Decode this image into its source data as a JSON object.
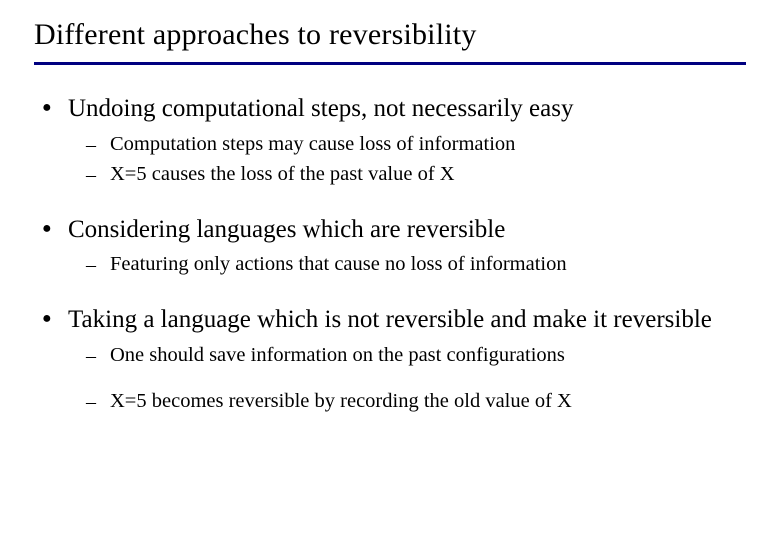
{
  "title": "Different approaches to reversibility",
  "items": [
    {
      "text": "Undoing computational steps, not necessarily easy",
      "sub": [
        {
          "text": "Computation steps may cause loss of information"
        },
        {
          "text": "X=5 causes the loss of the past value of X"
        }
      ]
    },
    {
      "text": "Considering languages which are reversible",
      "sub": [
        {
          "text": "Featuring only actions that cause no loss of information"
        }
      ]
    },
    {
      "text": "Taking a language which is not reversible and make it reversible",
      "sub": [
        {
          "text": "One should save information on the past configurations"
        },
        {
          "text": "X=5 becomes reversible by recording the old value of X"
        }
      ],
      "subSpaced": true
    }
  ],
  "glyphs": {
    "dot": "●",
    "dash": "–"
  }
}
